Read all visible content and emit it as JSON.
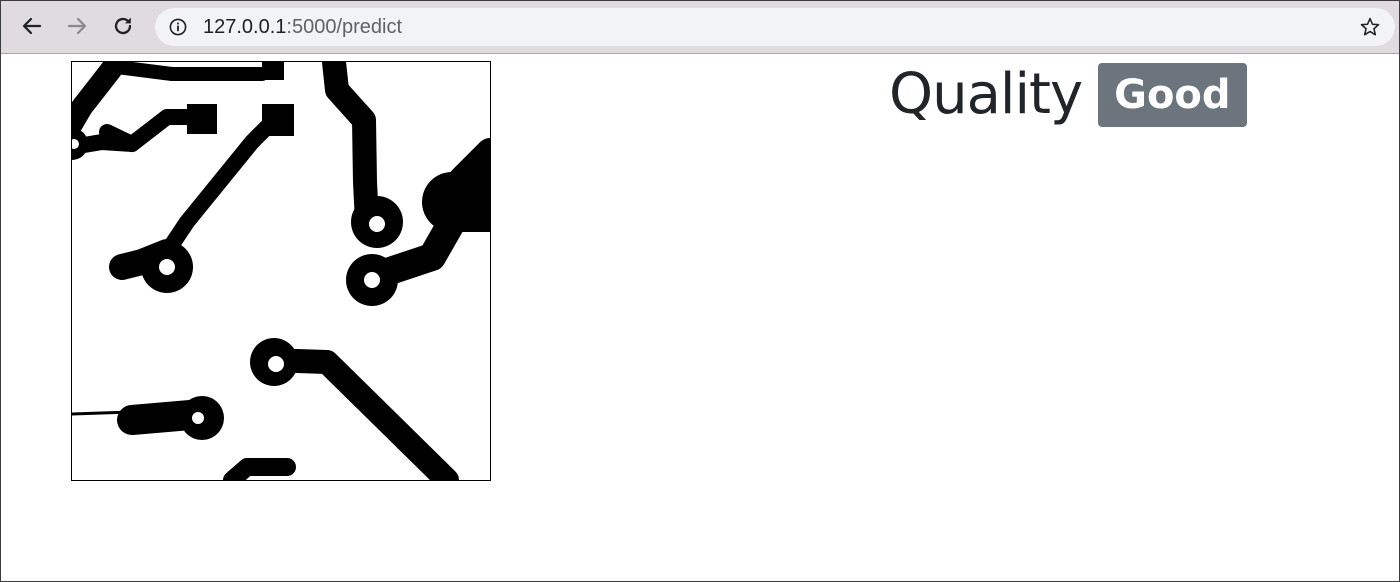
{
  "browser": {
    "url_host": "127.0.0.1",
    "url_path": ":5000/predict",
    "icons": {
      "back": "arrow-left-icon",
      "forward": "arrow-right-icon",
      "reload": "reload-icon",
      "site_info": "info-icon",
      "bookmark": "star-icon"
    }
  },
  "result": {
    "heading": "Quality",
    "badge": "Good",
    "badge_color": "#6c757d"
  },
  "image": {
    "content": "pcb-trace-image"
  }
}
